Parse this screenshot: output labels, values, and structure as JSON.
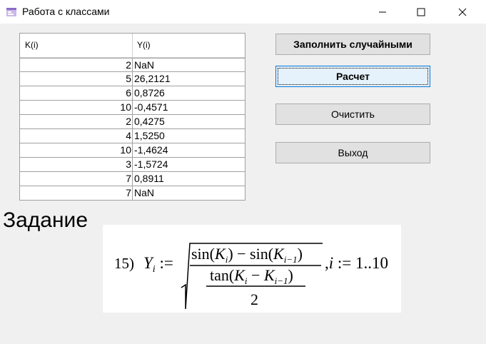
{
  "window": {
    "title": "Работа с классами",
    "app_icon": "app-form-icon",
    "controls": [
      "minimize-icon",
      "maximize-icon",
      "close-icon"
    ]
  },
  "grid": {
    "columns": [
      "K(i)",
      "Y(i)"
    ],
    "rows": [
      {
        "k": "2",
        "y": "NaN"
      },
      {
        "k": "5",
        "y": "26,2121"
      },
      {
        "k": "6",
        "y": "0,8726"
      },
      {
        "k": "10",
        "y": "-0,4571"
      },
      {
        "k": "2",
        "y": "0,4275"
      },
      {
        "k": "4",
        "y": "1,5250"
      },
      {
        "k": "10",
        "y": "-1,4624"
      },
      {
        "k": "3",
        "y": "-1,5724"
      },
      {
        "k": "7",
        "y": "0,8911"
      },
      {
        "k": "7",
        "y": "NaN"
      }
    ]
  },
  "buttons": {
    "fill": "Заполнить случайными",
    "calc": "Расчет",
    "clear": "Очистить",
    "exit": "Выход"
  },
  "task": {
    "label": "Задание",
    "formula": {
      "number": "15)",
      "lhs": "Yi :=",
      "numerator": "sin(Ki) − sin(Ki−1)",
      "denominator_top": "tan(Ki − Ki−1)",
      "denominator_bottom": "2",
      "range": ", i := 1..10"
    }
  },
  "colors": {
    "window_bg": "#f0f0f0",
    "titlebar_bg": "#ffffff",
    "button_bg": "#e1e1e1",
    "focused_button_bg": "#e5f1fb",
    "focused_button_border": "#0078d7"
  }
}
